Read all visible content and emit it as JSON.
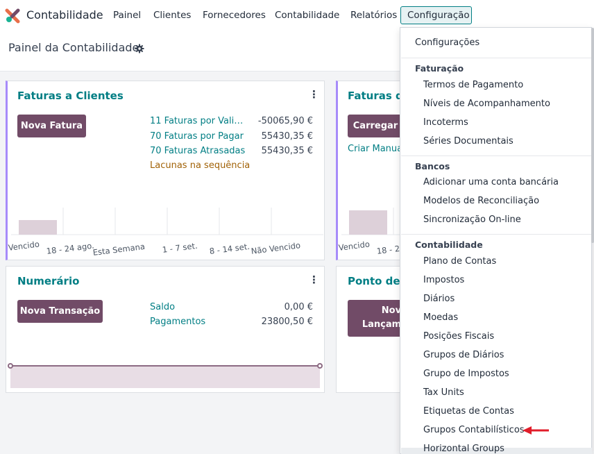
{
  "app": {
    "name": "Contabilidade"
  },
  "nav": {
    "items": [
      "Painel",
      "Clientes",
      "Fornecedores",
      "Contabilidade",
      "Relatórios"
    ],
    "active": "Configuração"
  },
  "page": {
    "title": "Painel da Contabilidade"
  },
  "cards": {
    "faturas_clientes": {
      "title": "Faturas a Clientes",
      "button": "Nova Fatura",
      "rows": [
        {
          "label": "11 Faturas por Vali…",
          "amount": "-50065,90 €"
        },
        {
          "label": "70 Faturas por Pagar",
          "amount": "55430,35 €"
        },
        {
          "label": "70 Faturas Atrasadas",
          "amount": "55430,35 €"
        }
      ],
      "warning": "Lacunas na sequência",
      "chart_labels": [
        "Vencido",
        "18 - 24 ago.",
        "Esta Semana",
        "1 - 7 set.",
        "8 - 14 set.",
        "Não Vencido"
      ]
    },
    "faturas_fornecedores": {
      "title": "Faturas de",
      "button": "Carregar",
      "link": "Criar Manua",
      "chart_labels": [
        "Vencido",
        "18 - 2"
      ]
    },
    "numerario": {
      "title": "Numerário",
      "button": "Nova Transação",
      "rows": [
        {
          "label": "Saldo",
          "amount": "0,00 €"
        },
        {
          "label": "Pagamentos",
          "amount": "23800,50 €"
        }
      ]
    },
    "ponto_venda": {
      "title": "Ponto de V",
      "button_line1": "Novo",
      "button_line2": "Lançame"
    }
  },
  "dropdown": {
    "top_item": "Configurações",
    "sections": [
      {
        "header": "Faturação",
        "items": [
          "Termos de Pagamento",
          "Níveis de Acompanhamento",
          "Incoterms",
          "Séries Documentais"
        ]
      },
      {
        "header": "Bancos",
        "items": [
          "Adicionar uma conta bancária",
          "Modelos de Reconciliação",
          "Sincronização On-line"
        ]
      },
      {
        "header": "Contabilidade",
        "items": [
          "Plano de Contas",
          "Impostos",
          "Diários",
          "Moedas",
          "Posições Fiscais",
          "Grupos de Diários",
          "Grupo de Impostos",
          "Tax Units",
          "Etiquetas de Contas",
          "Grupos Contabilísticos",
          "Horizontal Groups"
        ]
      }
    ],
    "highlighted": "Grupos Contabilísticos"
  },
  "colors": {
    "primary": "#714b67",
    "link": "#017e84",
    "warning": "#a16207",
    "accent_border": "#a78bfa",
    "arrow": "#e11d2a"
  },
  "icons": [
    "app-logo-icon",
    "gear-icon",
    "kebab-menu-icon",
    "red-arrow-icon"
  ]
}
